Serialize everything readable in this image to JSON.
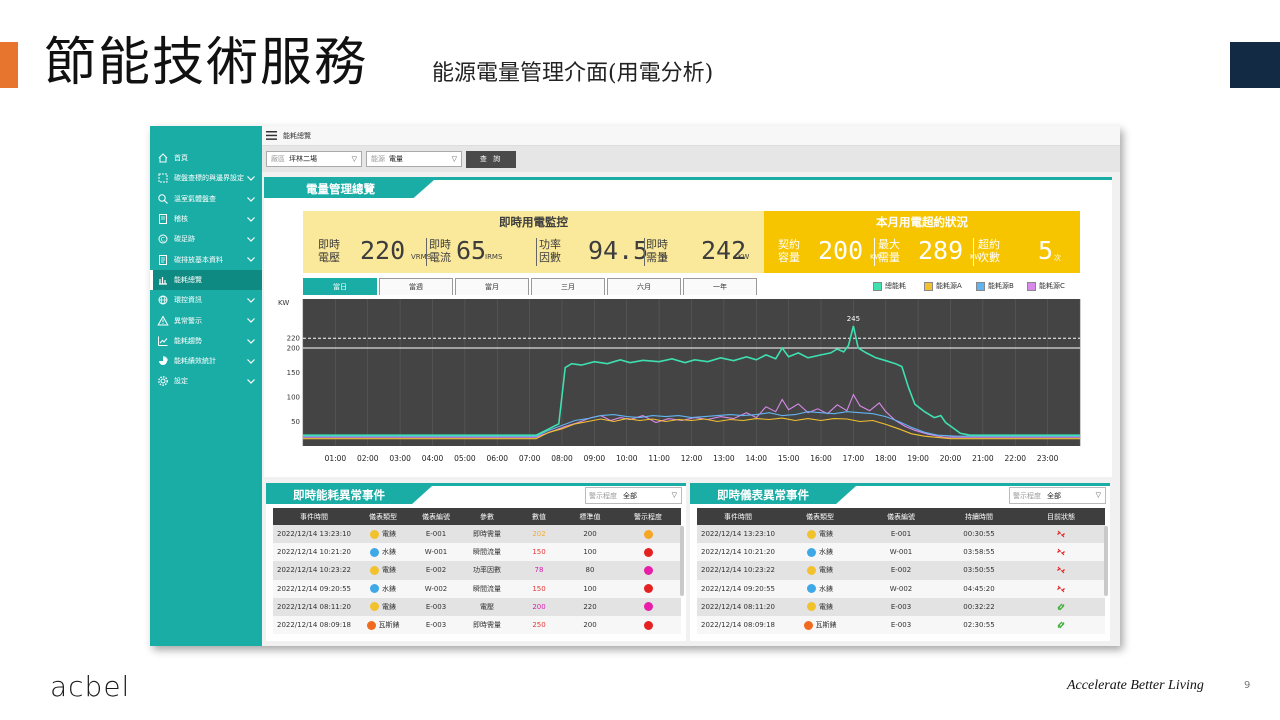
{
  "slide": {
    "title": "節能技術服務",
    "subtitle": "能源電量管理介面(用電分析)",
    "tagline": "Accelerate Better Living",
    "page_number": "9",
    "brand": "acbel",
    "colors": {
      "accent_orange": "#e8752e",
      "navy": "#122a44",
      "teal": "#1aada6"
    }
  },
  "sidebar": {
    "items": [
      {
        "label": "首頁",
        "icon": "home-icon",
        "has_chevron": false
      },
      {
        "label": "碳盤查標的與邊界設定",
        "icon": "boundary-icon",
        "has_chevron": true
      },
      {
        "label": "溫室氣體盤查",
        "icon": "search-icon",
        "has_chevron": true
      },
      {
        "label": "稽核",
        "icon": "audit-icon",
        "has_chevron": true
      },
      {
        "label": "碳足跡",
        "icon": "footprint-icon",
        "has_chevron": true
      },
      {
        "label": "碳排放基本資料",
        "icon": "document-icon",
        "has_chevron": true
      },
      {
        "label": "能耗總覽",
        "icon": "bar-chart-icon",
        "has_chevron": false,
        "active": true
      },
      {
        "label": "環控資訊",
        "icon": "globe-icon",
        "has_chevron": true
      },
      {
        "label": "異常警示",
        "icon": "warning-icon",
        "has_chevron": true
      },
      {
        "label": "能耗趨勢",
        "icon": "trend-icon",
        "has_chevron": true
      },
      {
        "label": "能耗績效統計",
        "icon": "pie-icon",
        "has_chevron": true
      },
      {
        "label": "設定",
        "icon": "gear-icon",
        "has_chevron": true
      }
    ]
  },
  "topbar": {
    "title": "能耗總覽"
  },
  "filters": {
    "site_label": "廠區",
    "site_value": "坪林二場",
    "energy_label": "能源",
    "energy_value": "電量",
    "query_button": "查 詢"
  },
  "overview": {
    "tab_title": "電量管理總覽",
    "realtime": {
      "title": "即時用電監控",
      "metrics": [
        {
          "label": "即時電壓",
          "value": "220",
          "unit": "VRMS"
        },
        {
          "label": "即時電流",
          "value": "65",
          "unit": "IRMS"
        },
        {
          "label": "功率因數",
          "value": "94.5",
          "unit": "%"
        },
        {
          "label": "即時需量",
          "value": "242",
          "unit": "KW"
        }
      ]
    },
    "contract": {
      "title": "本月用電超約狀況",
      "metrics": [
        {
          "label": "契約容量",
          "value": "200",
          "unit": "KW"
        },
        {
          "label": "最大需量",
          "value": "289",
          "unit": "KW"
        },
        {
          "label": "超約次數",
          "value": "5",
          "unit": "次"
        }
      ]
    },
    "range_tabs": [
      "當日",
      "當週",
      "當月",
      "三月",
      "六月",
      "一年"
    ],
    "active_range": 0,
    "legend": [
      {
        "name": "總能耗",
        "color": "#3ee0b0"
      },
      {
        "name": "能耗源A",
        "color": "#f2c12e"
      },
      {
        "name": "能耗源B",
        "color": "#61b4f0"
      },
      {
        "name": "能耗源C",
        "color": "#d889ea"
      }
    ]
  },
  "chart_data": {
    "type": "line",
    "ylabel": "KW",
    "ylim": [
      0,
      300
    ],
    "yticks": [
      50,
      100,
      150,
      200,
      220
    ],
    "xticks": [
      "01:00",
      "02:00",
      "03:00",
      "04:00",
      "05:00",
      "06:00",
      "07:00",
      "08:00",
      "09:00",
      "10:00",
      "11:00",
      "12:00",
      "13:00",
      "14:00",
      "15:00",
      "16:00",
      "17:00",
      "18:00",
      "19:00",
      "20:00",
      "21:00",
      "22:00",
      "23:00"
    ],
    "xlim": [
      0,
      24
    ],
    "reference_lines": [
      {
        "value": 220,
        "style": "dashed"
      },
      {
        "value": 200,
        "style": "solid"
      }
    ],
    "annotations": [
      {
        "x": 17.0,
        "y": 245,
        "text": "245"
      }
    ],
    "background": "#444444",
    "series": [
      {
        "name": "總能耗",
        "color": "#3ee0b0",
        "points": [
          [
            0,
            22
          ],
          [
            7.2,
            22
          ],
          [
            7.6,
            35
          ],
          [
            7.9,
            45
          ],
          [
            8.1,
            160
          ],
          [
            8.3,
            168
          ],
          [
            8.6,
            165
          ],
          [
            9.0,
            172
          ],
          [
            9.4,
            168
          ],
          [
            9.8,
            176
          ],
          [
            10.1,
            170
          ],
          [
            10.5,
            175
          ],
          [
            11.0,
            172
          ],
          [
            11.4,
            178
          ],
          [
            11.8,
            170
          ],
          [
            12.1,
            176
          ],
          [
            12.5,
            172
          ],
          [
            12.9,
            180
          ],
          [
            13.3,
            174
          ],
          [
            13.7,
            182
          ],
          [
            14.0,
            176
          ],
          [
            14.3,
            186
          ],
          [
            14.6,
            178
          ],
          [
            14.8,
            200
          ],
          [
            15.0,
            182
          ],
          [
            15.3,
            190
          ],
          [
            15.6,
            180
          ],
          [
            16.0,
            186
          ],
          [
            16.3,
            190
          ],
          [
            16.5,
            198
          ],
          [
            16.7,
            192
          ],
          [
            16.85,
            205
          ],
          [
            17.0,
            245
          ],
          [
            17.15,
            200
          ],
          [
            17.4,
            190
          ],
          [
            17.7,
            180
          ],
          [
            18.0,
            174
          ],
          [
            18.3,
            168
          ],
          [
            18.5,
            162
          ],
          [
            18.7,
            120
          ],
          [
            18.9,
            85
          ],
          [
            19.2,
            70
          ],
          [
            19.5,
            58
          ],
          [
            19.7,
            62
          ],
          [
            19.85,
            48
          ],
          [
            20.1,
            36
          ],
          [
            20.3,
            26
          ],
          [
            20.6,
            22
          ],
          [
            24,
            22
          ]
        ]
      },
      {
        "name": "能耗源A",
        "color": "#f2c12e",
        "points": [
          [
            0,
            15
          ],
          [
            7.2,
            15
          ],
          [
            7.6,
            28
          ],
          [
            8.0,
            35
          ],
          [
            8.4,
            45
          ],
          [
            8.8,
            50
          ],
          [
            9.2,
            55
          ],
          [
            9.6,
            50
          ],
          [
            10.0,
            56
          ],
          [
            10.4,
            52
          ],
          [
            10.8,
            55
          ],
          [
            11.2,
            50
          ],
          [
            11.6,
            54
          ],
          [
            12.0,
            52
          ],
          [
            12.4,
            55
          ],
          [
            12.8,
            50
          ],
          [
            13.2,
            54
          ],
          [
            13.6,
            52
          ],
          [
            14.0,
            56
          ],
          [
            14.4,
            54
          ],
          [
            14.8,
            57
          ],
          [
            15.2,
            52
          ],
          [
            15.6,
            56
          ],
          [
            16.0,
            52
          ],
          [
            16.4,
            56
          ],
          [
            16.8,
            55
          ],
          [
            17.2,
            50
          ],
          [
            17.6,
            52
          ],
          [
            18.0,
            44
          ],
          [
            18.4,
            35
          ],
          [
            18.8,
            25
          ],
          [
            19.2,
            20
          ],
          [
            20.0,
            15
          ],
          [
            24,
            15
          ]
        ]
      },
      {
        "name": "能耗源B",
        "color": "#61b4f0",
        "points": [
          [
            0,
            20
          ],
          [
            7.2,
            20
          ],
          [
            7.6,
            32
          ],
          [
            8.0,
            42
          ],
          [
            8.4,
            52
          ],
          [
            8.8,
            56
          ],
          [
            9.2,
            62
          ],
          [
            9.6,
            64
          ],
          [
            10.0,
            60
          ],
          [
            10.4,
            58
          ],
          [
            10.8,
            62
          ],
          [
            11.2,
            60
          ],
          [
            11.6,
            62
          ],
          [
            12.0,
            58
          ],
          [
            12.4,
            60
          ],
          [
            12.8,
            62
          ],
          [
            13.2,
            64
          ],
          [
            13.6,
            62
          ],
          [
            14.0,
            64
          ],
          [
            14.4,
            68
          ],
          [
            14.8,
            62
          ],
          [
            15.2,
            64
          ],
          [
            15.6,
            70
          ],
          [
            16.0,
            68
          ],
          [
            16.4,
            66
          ],
          [
            16.8,
            70
          ],
          [
            17.2,
            68
          ],
          [
            17.6,
            66
          ],
          [
            18.0,
            60
          ],
          [
            18.4,
            50
          ],
          [
            18.8,
            38
          ],
          [
            19.2,
            28
          ],
          [
            19.6,
            22
          ],
          [
            20.2,
            20
          ],
          [
            24,
            20
          ]
        ]
      },
      {
        "name": "能耗源C",
        "color": "#d889ea",
        "points": [
          [
            0,
            18
          ],
          [
            7.2,
            18
          ],
          [
            7.7,
            30
          ],
          [
            8.1,
            40
          ],
          [
            8.5,
            48
          ],
          [
            8.9,
            58
          ],
          [
            9.2,
            62
          ],
          [
            9.5,
            52
          ],
          [
            9.8,
            58
          ],
          [
            10.1,
            54
          ],
          [
            10.5,
            62
          ],
          [
            10.9,
            48
          ],
          [
            11.3,
            56
          ],
          [
            11.7,
            52
          ],
          [
            12.1,
            58
          ],
          [
            12.5,
            54
          ],
          [
            12.9,
            60
          ],
          [
            13.3,
            56
          ],
          [
            13.7,
            68
          ],
          [
            14.0,
            58
          ],
          [
            14.3,
            80
          ],
          [
            14.6,
            70
          ],
          [
            14.8,
            95
          ],
          [
            15.0,
            74
          ],
          [
            15.3,
            86
          ],
          [
            15.6,
            68
          ],
          [
            15.9,
            76
          ],
          [
            16.2,
            66
          ],
          [
            16.5,
            84
          ],
          [
            16.8,
            72
          ],
          [
            17.0,
            105
          ],
          [
            17.2,
            82
          ],
          [
            17.5,
            72
          ],
          [
            17.8,
            88
          ],
          [
            18.0,
            70
          ],
          [
            18.3,
            52
          ],
          [
            18.6,
            40
          ],
          [
            18.9,
            32
          ],
          [
            19.3,
            24
          ],
          [
            19.8,
            18
          ],
          [
            24,
            18
          ]
        ]
      }
    ]
  },
  "energy_events": {
    "title": "即時能耗異常事件",
    "filter_label": "警示程度",
    "filter_value": "全部",
    "columns": [
      "事件時間",
      "儀表類型",
      "儀表編號",
      "參數",
      "數值",
      "標準值",
      "警示程度"
    ],
    "rows": [
      {
        "time": "2022/12/14 13:23:10",
        "type": "電錶",
        "type_color": "#f2c12e",
        "meter": "E-001",
        "param": "即時需量",
        "value": "202",
        "value_color": "#f2a93b",
        "std": "200",
        "level_color": "#f5a623"
      },
      {
        "time": "2022/12/14 10:21:20",
        "type": "水錶",
        "type_color": "#3fa9e8",
        "meter": "W-001",
        "param": "瞬間流量",
        "value": "150",
        "value_color": "#e53935",
        "std": "100",
        "level_color": "#e52222"
      },
      {
        "time": "2022/12/14 10:23:22",
        "type": "電錶",
        "type_color": "#f2c12e",
        "meter": "E-002",
        "param": "功率因數",
        "value": "78",
        "value_color": "#d81bb0",
        "std": "80",
        "level_color": "#e81ea8"
      },
      {
        "time": "2022/12/14 09:20:55",
        "type": "水錶",
        "type_color": "#3fa9e8",
        "meter": "W-002",
        "param": "瞬間流量",
        "value": "150",
        "value_color": "#e53935",
        "std": "100",
        "level_color": "#e52222"
      },
      {
        "time": "2022/12/14 08:11:20",
        "type": "電錶",
        "type_color": "#f2c12e",
        "meter": "E-003",
        "param": "電壓",
        "value": "200",
        "value_color": "#d81bb0",
        "std": "220",
        "level_color": "#e81ea8"
      },
      {
        "time": "2022/12/14 08:09:18",
        "type": "瓦斯錶",
        "type_color": "#f06a1f",
        "meter": "E-003",
        "param": "即時需量",
        "value": "250",
        "value_color": "#e53935",
        "std": "200",
        "level_color": "#e52222"
      }
    ]
  },
  "meter_events": {
    "title": "即時儀表異常事件",
    "filter_label": "警示程度",
    "filter_value": "全部",
    "columns": [
      "事件時間",
      "儀表類型",
      "儀表編號",
      "持續時間",
      "目前狀態"
    ],
    "rows": [
      {
        "time": "2022/12/14 13:23:10",
        "type": "電錶",
        "type_color": "#f2c12e",
        "meter": "E-001",
        "duration": "00:30:55",
        "status": "disconnected",
        "status_color": "#e52222"
      },
      {
        "time": "2022/12/14 10:21:20",
        "type": "水錶",
        "type_color": "#3fa9e8",
        "meter": "W-001",
        "duration": "03:58:55",
        "status": "disconnected",
        "status_color": "#e52222"
      },
      {
        "time": "2022/12/14 10:23:22",
        "type": "電錶",
        "type_color": "#f2c12e",
        "meter": "E-002",
        "duration": "03:50:55",
        "status": "disconnected",
        "status_color": "#e52222"
      },
      {
        "time": "2022/12/14 09:20:55",
        "type": "水錶",
        "type_color": "#3fa9e8",
        "meter": "W-002",
        "duration": "04:45:20",
        "status": "disconnected",
        "status_color": "#e52222"
      },
      {
        "time": "2022/12/14 08:11:20",
        "type": "電錶",
        "type_color": "#f2c12e",
        "meter": "E-003",
        "duration": "00:32:22",
        "status": "connected",
        "status_color": "#43b03f"
      },
      {
        "time": "2022/12/14 08:09:18",
        "type": "瓦斯錶",
        "type_color": "#f06a1f",
        "meter": "E-003",
        "duration": "02:30:55",
        "status": "connected",
        "status_color": "#43b03f"
      }
    ]
  }
}
